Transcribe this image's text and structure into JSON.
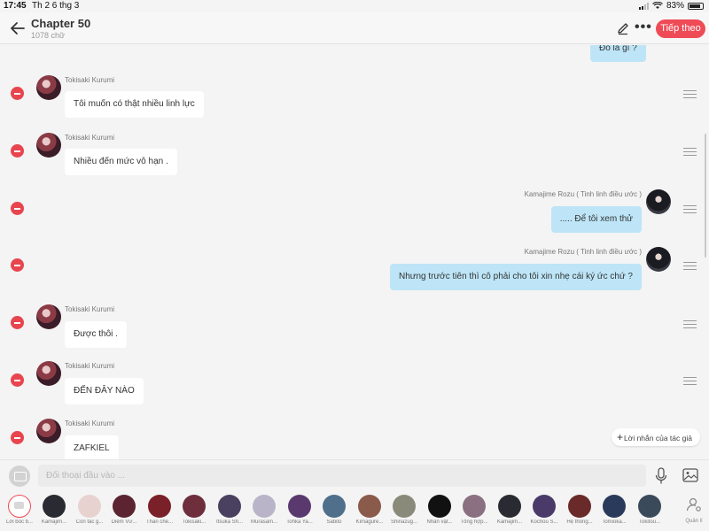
{
  "status_bar": {
    "time": "17:45",
    "date": "Th 2 6 thg 3",
    "battery": "83%"
  },
  "header": {
    "title": "Chapter 50",
    "subtitle": "1078 chữ",
    "next_label": "Tiếp theo",
    "more_label": "•••"
  },
  "messages": [
    {
      "side": "right",
      "name": "",
      "text": "Đó là gì ?"
    },
    {
      "side": "left",
      "name": "Tokisaki Kurumi",
      "text": "Tôi muốn có thật nhiều linh lực"
    },
    {
      "side": "left",
      "name": "Tokisaki Kurumi",
      "text": "Nhiều đến mức vô hạn ."
    },
    {
      "side": "right",
      "name": "Kamajime Rozu ( Tinh linh điều ước )",
      "text": "..... Để tôi xem thử"
    },
    {
      "side": "right",
      "name": "Kamajime Rozu ( Tinh linh điều ước )",
      "text": "Nhưng trước tiên thì cô phải cho tôi xin nhẹ cái ký ức chứ ?"
    },
    {
      "side": "left",
      "name": "Tokisaki Kurumi",
      "text": "Được thôi ."
    },
    {
      "side": "left",
      "name": "Tokisaki Kurumi",
      "text": "ĐẾN ĐÂY NÀO"
    },
    {
      "side": "left",
      "name": "Tokisaki Kurumi",
      "text": "ZAFKIEL"
    }
  ],
  "author_note_label": "Lời nhắn của tác giả",
  "input": {
    "placeholder": "Đối thoại đầu vào ..."
  },
  "characters": [
    {
      "label": "Lời bốc b...",
      "color": "#ffffff"
    },
    {
      "label": "Kamajim...",
      "color": "#2a2a32"
    },
    {
      "label": "Con tác g...",
      "color": "#e8d2cf"
    },
    {
      "label": "Diêm Vư...",
      "color": "#5b2430"
    },
    {
      "label": "Thần chế...",
      "color": "#7a2028"
    },
    {
      "label": "Tokisaki...",
      "color": "#6e2e3c"
    },
    {
      "label": "Itsuka Sh...",
      "color": "#4a4060"
    },
    {
      "label": "Murasam...",
      "color": "#b9b4c8"
    },
    {
      "label": "Tohka Ya...",
      "color": "#5a3a6e"
    },
    {
      "label": "Sabito",
      "color": "#4f6f8a"
    },
    {
      "label": "Kimagure...",
      "color": "#8a5a4a"
    },
    {
      "label": "Shinazug...",
      "color": "#8a8a7a"
    },
    {
      "label": "Nhân vật...",
      "color": "#111111"
    },
    {
      "label": "Tổng hợp...",
      "color": "#8a7080"
    },
    {
      "label": "Kamajim...",
      "color": "#2a2a32"
    },
    {
      "label": "Kochou S...",
      "color": "#4a3a6a"
    },
    {
      "label": "Hệ thống...",
      "color": "#6a2a2a"
    },
    {
      "label": "Tomioka...",
      "color": "#2a3a5a"
    },
    {
      "label": "Tokitou...",
      "color": "#3a4a5a"
    }
  ],
  "manage_label": "Quản lí"
}
